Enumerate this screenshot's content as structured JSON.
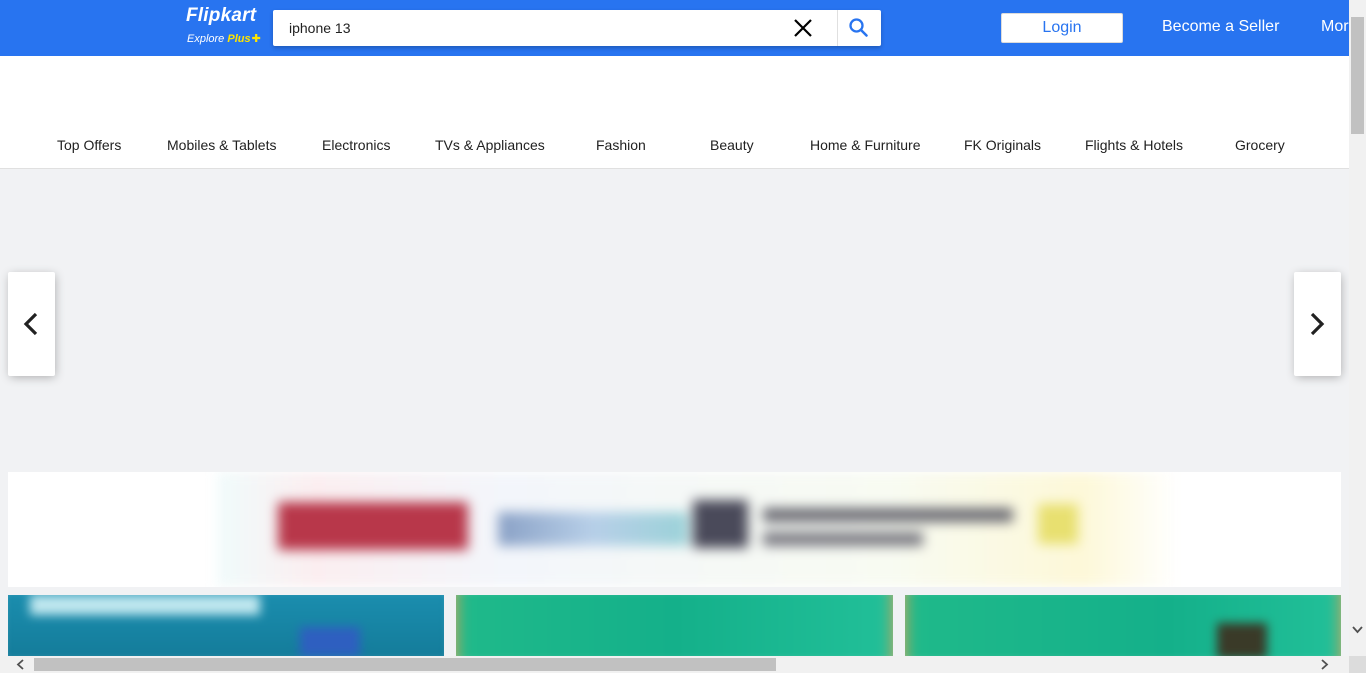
{
  "header": {
    "logo_text": "Flipkart",
    "logo_tagline": "Explore",
    "logo_plus": "Plus",
    "search_value": "iphone 13",
    "login_label": "Login",
    "seller_label": "Become a Seller",
    "more_label": "More"
  },
  "categories": [
    "Top Offers",
    "Mobiles & Tablets",
    "Electronics",
    "TVs & Appliances",
    "Fashion",
    "Beauty",
    "Home & Furniture",
    "FK Originals",
    "Flights & Hotels",
    "Grocery"
  ],
  "colors": {
    "brand_blue": "#2874f0",
    "plus_yellow": "#ffe500",
    "page_bg": "#f1f2f4"
  },
  "icons": {
    "clear": "close-icon",
    "search": "search-icon",
    "prev": "chevron-left-icon",
    "next": "chevron-right-icon"
  }
}
